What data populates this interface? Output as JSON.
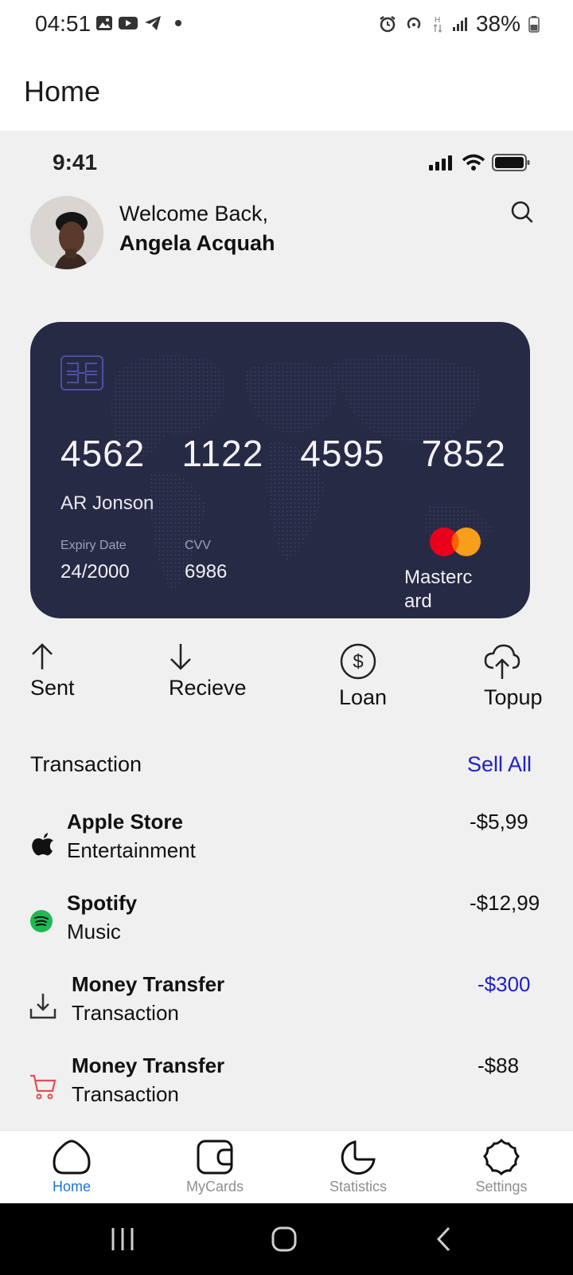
{
  "system_status": {
    "time": "04:51",
    "battery": "38%"
  },
  "header": {
    "title": "Home"
  },
  "mock_status": {
    "time": "9:41"
  },
  "user": {
    "greeting": "Welcome Back,",
    "name": "Angela Acquah"
  },
  "card": {
    "number_groups": [
      "4562",
      "1122",
      "4595",
      "7852"
    ],
    "holder": "AR Jonson",
    "expiry_label": "Expiry Date",
    "expiry": "24/2000",
    "cvv_label": "CVV",
    "cvv": "6986",
    "brand": "Masterc ard",
    "color": "#272a45"
  },
  "actions": [
    {
      "label": "Sent",
      "icon": "arrow-up-icon"
    },
    {
      "label": "Recieve",
      "icon": "arrow-down-icon"
    },
    {
      "label": "Loan",
      "icon": "dollar-circle-icon"
    },
    {
      "label": "Topup",
      "icon": "cloud-upload-icon"
    }
  ],
  "transactions_section": {
    "title": "Transaction",
    "see_all": "Sell All"
  },
  "transactions": [
    {
      "name": "Apple Store",
      "category": "Entertainment",
      "amount": "-$5,99",
      "icon": "apple-icon"
    },
    {
      "name": "Spotify",
      "category": "Music",
      "amount": "-$12,99",
      "icon": "spotify-icon"
    },
    {
      "name": "Money Transfer",
      "category": "Transaction",
      "amount": "-$300",
      "icon": "download-icon",
      "amount_color": "#2121c4"
    },
    {
      "name": "Money Transfer",
      "category": "Transaction",
      "amount": "-$88",
      "icon": "cart-icon"
    }
  ],
  "tabs": [
    {
      "label": "Home",
      "icon": "home-icon",
      "active": true
    },
    {
      "label": "MyCards",
      "icon": "cards-icon",
      "active": false
    },
    {
      "label": "Statistics",
      "icon": "statistics-icon",
      "active": false
    },
    {
      "label": "Settings",
      "icon": "settings-icon",
      "active": false
    }
  ],
  "colors": {
    "accent": "#1976d2",
    "link": "#2121c4",
    "spotify": "#1db954",
    "cart": "#e05050"
  }
}
